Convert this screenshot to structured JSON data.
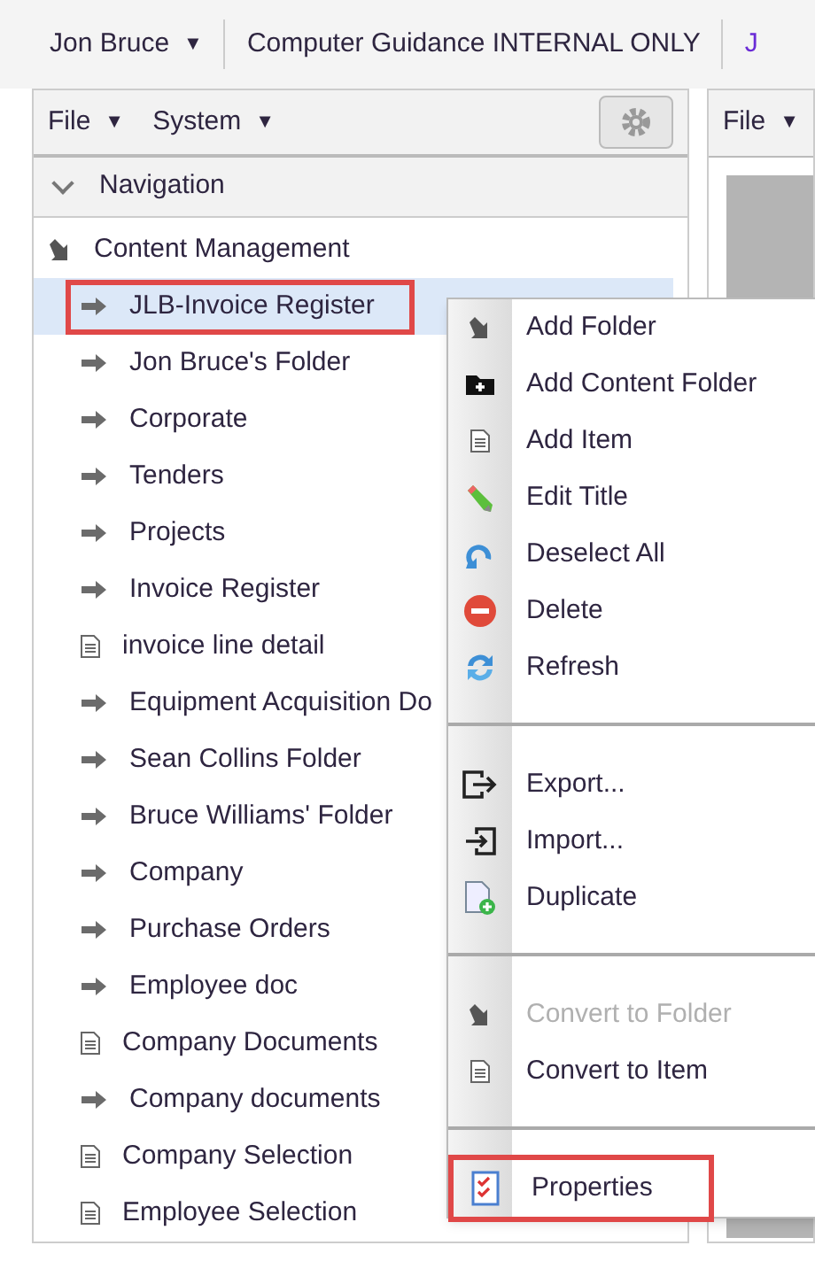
{
  "top_bar": {
    "user": "Jon Bruce",
    "caret": "▼",
    "company": "Computer Guidance INTERNAL ONLY",
    "cut_link": "J"
  },
  "left_panel": {
    "menus": [
      {
        "label": "File",
        "caret": "▼"
      },
      {
        "label": "System",
        "caret": "▼"
      }
    ],
    "navigation": {
      "title": "Navigation",
      "expanded": true
    },
    "tree": {
      "label": "Content Management",
      "expanded": true,
      "children": [
        {
          "label": "JLB-Invoice Register",
          "kind": "folder",
          "selected": true,
          "highlighted": true
        },
        {
          "label": "Jon Bruce's Folder",
          "kind": "folder",
          "selected": false,
          "highlighted": false
        },
        {
          "label": "Corporate",
          "kind": "folder",
          "selected": false,
          "highlighted": false
        },
        {
          "label": "Tenders",
          "kind": "folder",
          "selected": false,
          "highlighted": false
        },
        {
          "label": "Projects",
          "kind": "folder",
          "selected": false,
          "highlighted": false
        },
        {
          "label": "Invoice Register",
          "kind": "folder",
          "selected": false,
          "highlighted": false
        },
        {
          "label": "invoice line detail",
          "kind": "item",
          "selected": false,
          "highlighted": false
        },
        {
          "label": "Equipment Acquisition Do",
          "kind": "folder",
          "selected": false,
          "highlighted": false
        },
        {
          "label": "Sean Collins Folder",
          "kind": "folder",
          "selected": false,
          "highlighted": false
        },
        {
          "label": "Bruce Williams' Folder",
          "kind": "folder",
          "selected": false,
          "highlighted": false
        },
        {
          "label": "Company",
          "kind": "folder",
          "selected": false,
          "highlighted": false
        },
        {
          "label": "Purchase Orders",
          "kind": "folder",
          "selected": false,
          "highlighted": false
        },
        {
          "label": "Employee doc",
          "kind": "folder",
          "selected": false,
          "highlighted": false
        },
        {
          "label": "Company Documents",
          "kind": "item",
          "selected": false,
          "highlighted": false
        },
        {
          "label": "Company documents",
          "kind": "folder",
          "selected": false,
          "highlighted": false
        },
        {
          "label": "Company Selection",
          "kind": "item",
          "selected": false,
          "highlighted": false
        },
        {
          "label": "Employee Selection",
          "kind": "item",
          "selected": false,
          "highlighted": false
        }
      ]
    }
  },
  "right_panel": {
    "menu": {
      "label": "File",
      "caret": "▼"
    }
  },
  "context_menu": {
    "groups": [
      [
        {
          "label": "Add Folder",
          "kind": "convert",
          "disabled": false,
          "highlighted": false
        },
        {
          "label": "Add Content Folder",
          "kind": "folder-plus",
          "disabled": false,
          "highlighted": false
        },
        {
          "label": "Add Item",
          "kind": "doc",
          "disabled": false,
          "highlighted": false
        },
        {
          "label": "Edit Title",
          "kind": "pencil",
          "disabled": false,
          "highlighted": false
        },
        {
          "label": "Deselect All",
          "kind": "undo",
          "disabled": false,
          "highlighted": false
        },
        {
          "label": "Delete",
          "kind": "delete",
          "disabled": false,
          "highlighted": false
        },
        {
          "label": "Refresh",
          "kind": "refresh",
          "disabled": false,
          "highlighted": false
        }
      ],
      [
        {
          "label": "Export...",
          "kind": "export",
          "disabled": false,
          "highlighted": false
        },
        {
          "label": "Import...",
          "kind": "import",
          "disabled": false,
          "highlighted": false
        },
        {
          "label": "Duplicate",
          "kind": "duplicate",
          "disabled": false,
          "highlighted": false
        }
      ],
      [
        {
          "label": "Convert to Folder",
          "kind": "convert",
          "disabled": true,
          "highlighted": false
        },
        {
          "label": "Convert to Item",
          "kind": "doc",
          "disabled": false,
          "highlighted": false
        }
      ],
      [
        {
          "label": "Properties",
          "kind": "checklist",
          "disabled": false,
          "highlighted": true
        }
      ]
    ]
  }
}
